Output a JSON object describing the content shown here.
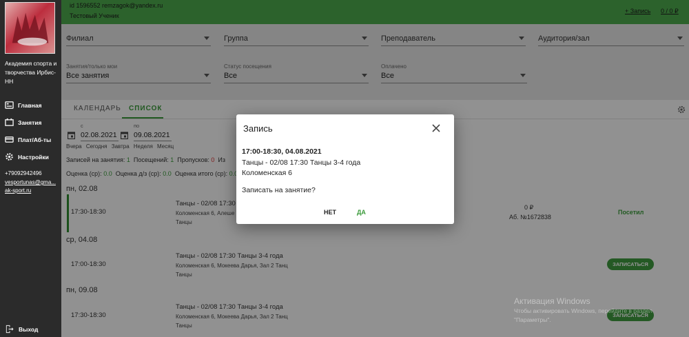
{
  "sidebar": {
    "org_name": "Академия спорта и творчества Ирбис-НН",
    "items": [
      {
        "label": "Главная",
        "icon": "dashboard-icon"
      },
      {
        "label": "Занятия",
        "icon": "lessons-icon"
      },
      {
        "label": "Плат/Аб-ты",
        "icon": "payments-icon"
      },
      {
        "label": "Настройки",
        "icon": "settings-icon"
      }
    ],
    "phone": "+79092942496",
    "email_line1": "vesportunas@gma...",
    "email_line2": "ak-sport.ru",
    "logout": "Выход"
  },
  "header": {
    "user_id": "id 1596552 remzagok@yandex.ru",
    "user_name": "Тестовый Ученик",
    "add_link": "+ Запись",
    "balance": "0 / 0 ₽"
  },
  "filters": {
    "branch": "Филиал",
    "group": "Группа",
    "teacher": "Преподаватель",
    "room": "Аудитория/зал",
    "lessons_label": "Занятия/только мои",
    "lessons_value": "Все занятия",
    "attendance_label": "Статус посещения",
    "attendance_value": "Все",
    "paid_label": "Оплачено",
    "paid_value": "Все"
  },
  "tabs": {
    "calendar": "КАЛЕНДАРЬ",
    "list": "СПИСОК"
  },
  "dates": {
    "from_label": "с",
    "from_value": "02.08.2021",
    "to_label": "по",
    "to_value": "09.08.2021",
    "quick": [
      "Вчера",
      "Сегодня",
      "Завтра",
      "Неделя",
      "Месяц"
    ]
  },
  "stats": {
    "enrolled_label": "Записей на занятия:",
    "enrolled": "1",
    "visits_label": "Посещений:",
    "visits": "1",
    "missed_label": "Пропусков:",
    "missed": "0",
    "from_label": "Из",
    "grade_label": "Оценка (ср):",
    "grade": "0.0",
    "grade_hw_label": "Оценка д/з (ср):",
    "grade_hw": "0.0",
    "grade_total_label": "Оценка итого (ср):",
    "grade_total": "0.0"
  },
  "days": [
    {
      "date": "пн, 02.08",
      "time": "17:30-18:30",
      "title": "Танцы - 02/08 17:30 Т",
      "location": "Коломенская 6, Алеше",
      "kind": "Танцы",
      "price": "0 ₽",
      "abonement": "Аб. №1672838",
      "status": "Посетил"
    },
    {
      "date": "ср, 04.08",
      "time": "17:00-18:30",
      "title": "Танцы - 02/08 17:30 Танцы 3-4 года",
      "location": "Коломенская 6, Мокеева Дарья, Зал 2 Танц",
      "kind": "Танцы",
      "action": "ЗАПИСАТЬСЯ"
    },
    {
      "date": "пн, 09.08",
      "time": "17:30-18:30",
      "title": "Танцы - 02/08 17:30 Танцы 3-4 года",
      "location": "Коломенская 6, Мокеева Дарья, Зал 2 Танц",
      "kind": "Танцы",
      "action": "ЗАПИСАТЬСЯ"
    }
  ],
  "modal": {
    "title": "Запись",
    "line1": "17:00-18:30, 04.08.2021",
    "line2": "Танцы - 02/08 17:30 Танцы 3-4 года",
    "line3": "Коломенская 6",
    "question": "Записать на занятие?",
    "no": "НЕТ",
    "yes": "ДА"
  },
  "watermark": {
    "line1": "Активация Windows",
    "line2": "Чтобы активировать Windows, перейдите в раздел",
    "line3": "\"Параметры\"."
  },
  "colors": {
    "accent": "#4caa4c",
    "sidebar": "#2b2b2b",
    "danger": "#dd3333"
  }
}
